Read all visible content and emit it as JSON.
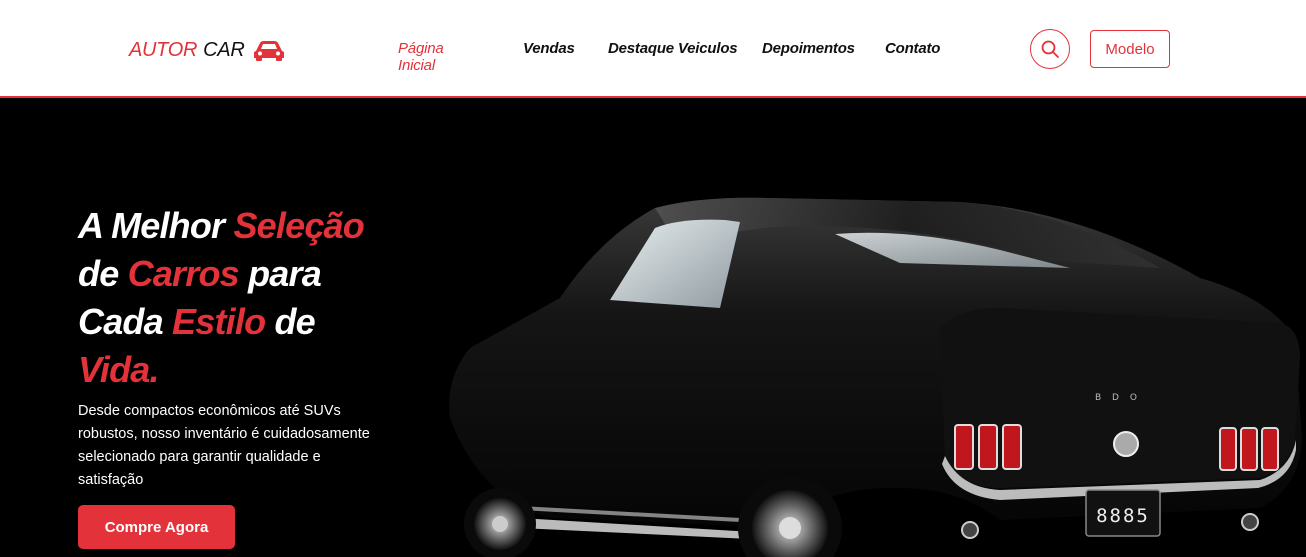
{
  "logo": {
    "part1": "AUTOR",
    "part2": "CAR",
    "icon": "car-icon"
  },
  "nav": {
    "items": [
      {
        "label": "Página Inicial",
        "active": true
      },
      {
        "label": "Vendas",
        "active": false
      },
      {
        "label": "Destaque Veiculos",
        "active": false
      },
      {
        "label": "Depoimentos",
        "active": false
      },
      {
        "label": "Contato",
        "active": false
      }
    ]
  },
  "header": {
    "search_icon": "search-icon",
    "modelo_label": "Modelo"
  },
  "hero": {
    "headline": {
      "w1": "A Melhor ",
      "w2": "Seleção",
      "w3": "de ",
      "w4": "Carros",
      "w5": " para",
      "w6": "Cada ",
      "w7": "Estilo",
      "w8": " de",
      "w9": "Vida."
    },
    "description": "Desde compactos econômicos até SUVs robustos, nosso inventário é cuidadosamente selecionado para garantir qualidade e satisfação",
    "cta_label": "Compre Agora",
    "car_plate": "8885",
    "car_badge": "B D O"
  },
  "colors": {
    "accent": "#e3323a",
    "background": "#000000",
    "header_bg": "#ffffff"
  }
}
